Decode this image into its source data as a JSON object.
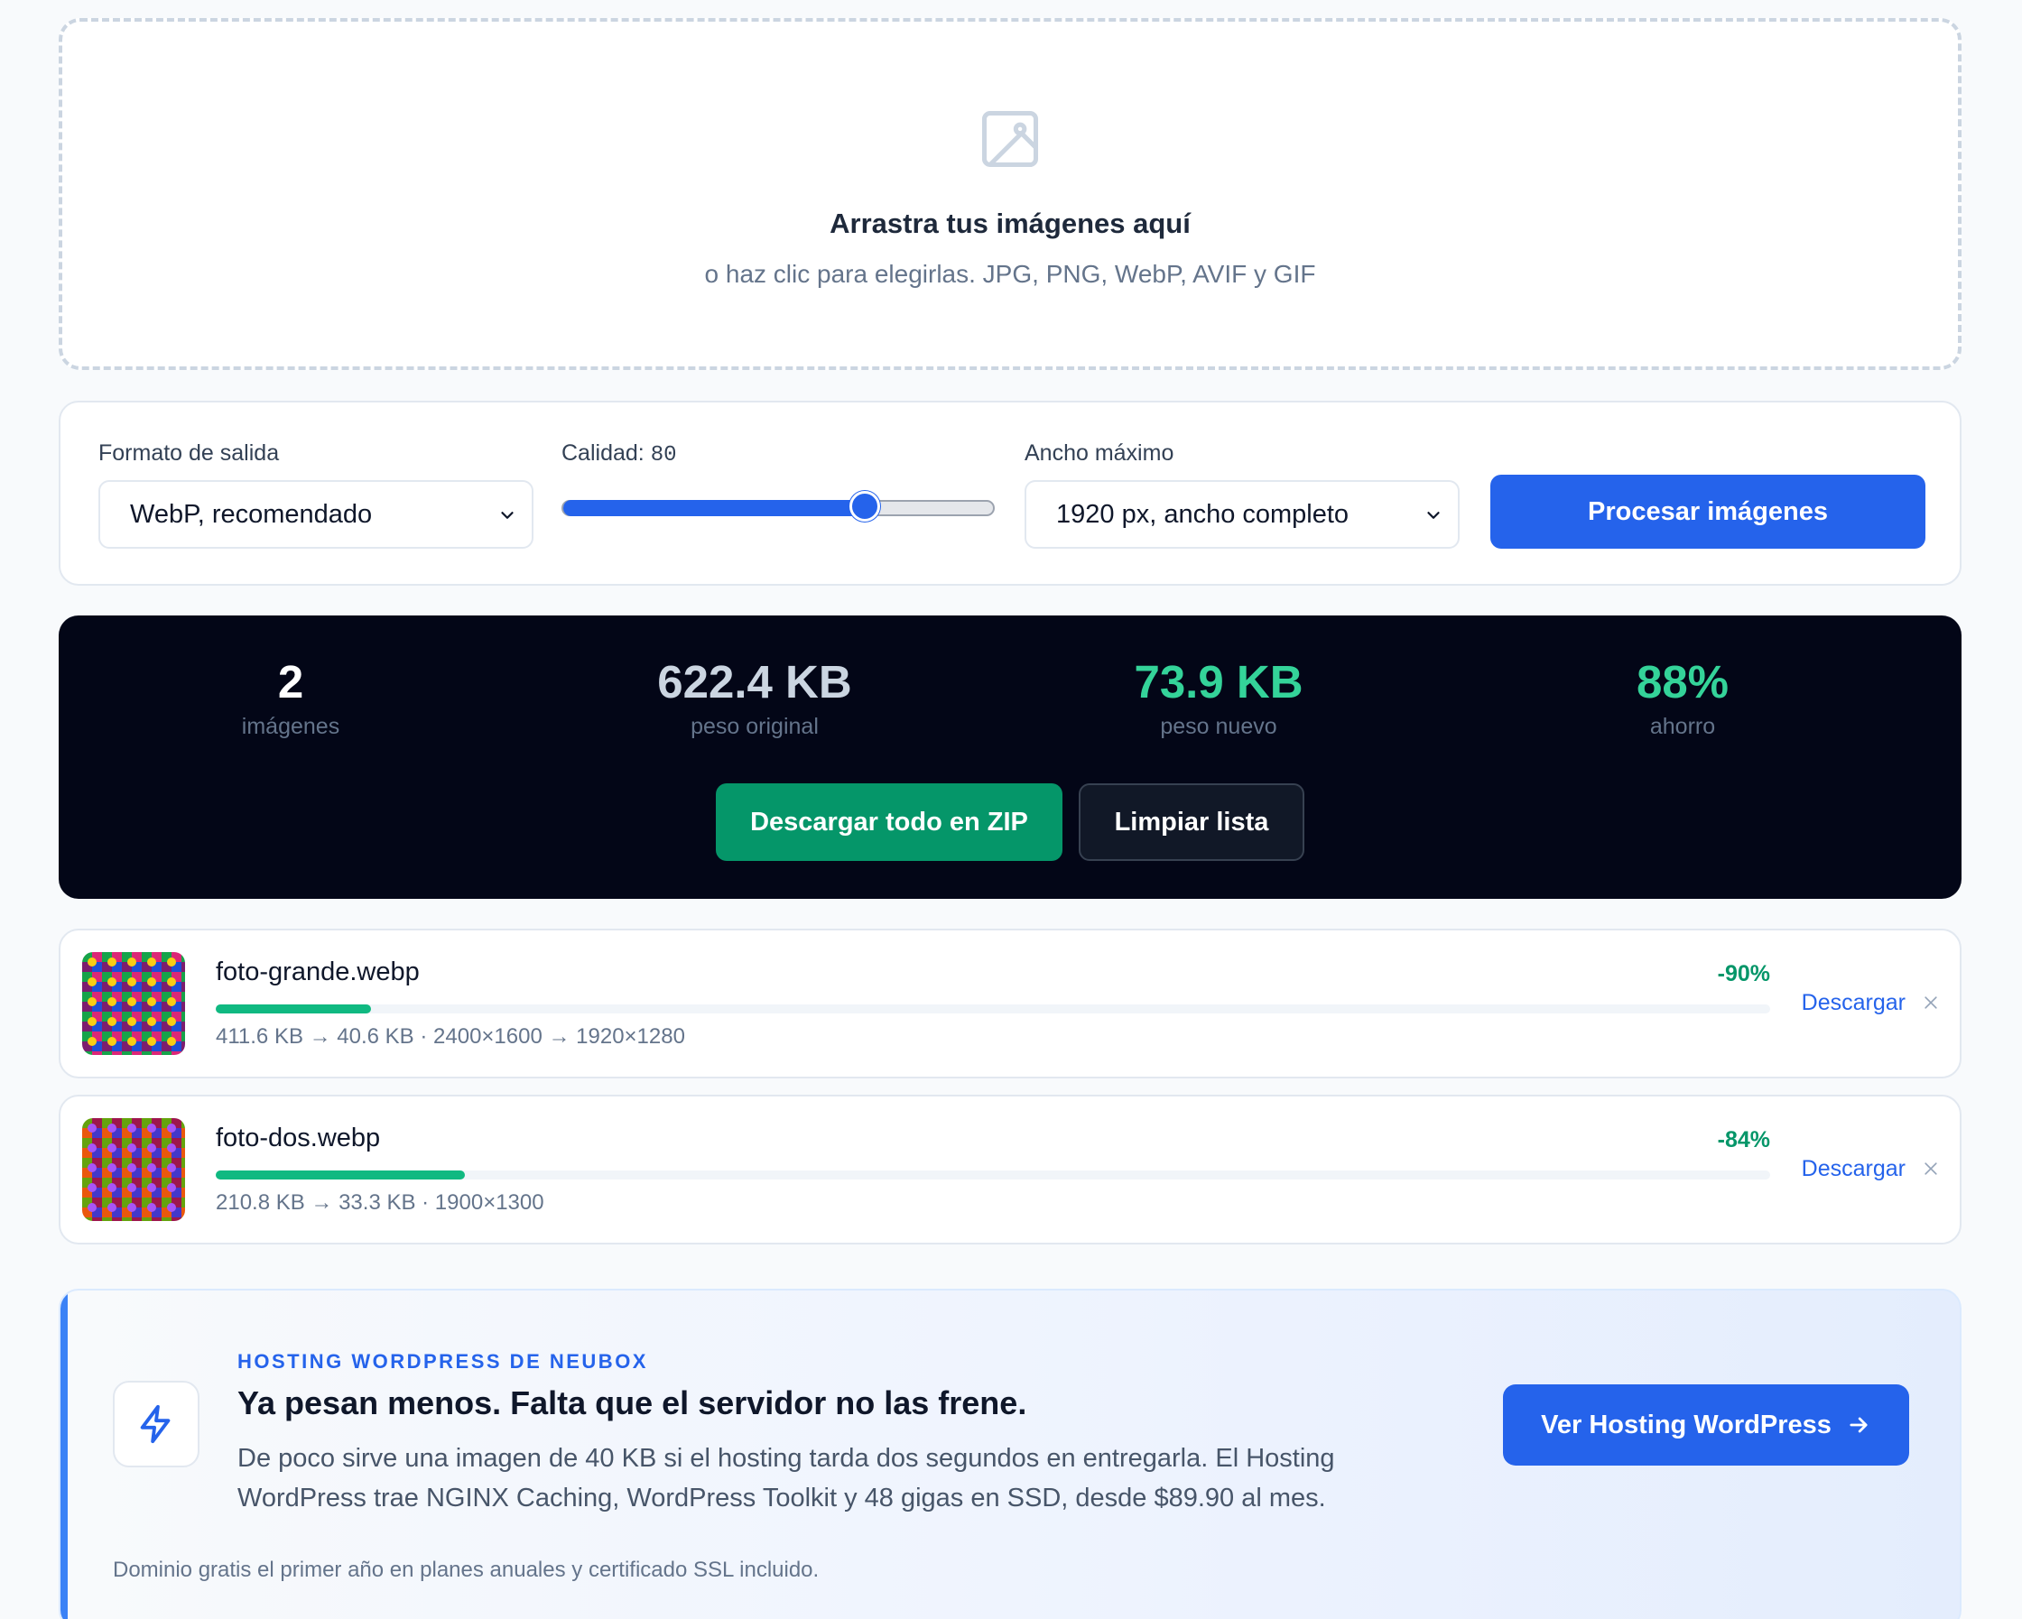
{
  "dropzone": {
    "icon": "image-icon",
    "title": "Arrastra tus imágenes aquí",
    "subtitle": "o haz clic para elegirlas. JPG, PNG, WebP, AVIF y GIF"
  },
  "options": {
    "format_label": "Formato de salida",
    "format_value": "WebP, recomendado",
    "quality_label": "Calidad:",
    "quality_value": "80",
    "quality_fraction": 0.7,
    "width_label": "Ancho máximo",
    "width_value": "1920 px, ancho completo",
    "process_label": "Procesar imágenes"
  },
  "stats": {
    "count": "2",
    "count_label": "imágenes",
    "original": "622.4 KB",
    "original_label": "peso original",
    "new": "73.9 KB",
    "new_label": "peso nuevo",
    "saving": "88%",
    "saving_label": "ahorro",
    "zip_label": "Descargar todo en ZIP",
    "clear_label": "Limpiar lista",
    "colors": {
      "white": "#ffffff",
      "muted": "#cbd5e1",
      "green": "#34d399"
    }
  },
  "files": [
    {
      "name": "foto-grande.webp",
      "percent": "-90%",
      "progress": 0.1,
      "meta": "411.6 KB → 40.6 KB · 2400×1600 → 1920×1280",
      "download": "Descargar"
    },
    {
      "name": "foto-dos.webp",
      "percent": "-84%",
      "progress": 0.16,
      "meta": "210.8 KB → 33.3 KB · 1900×1300",
      "download": "Descargar"
    }
  ],
  "promo": {
    "icon": "lightning-icon",
    "kicker": "HOSTING WORDPRESS DE NEUBOX",
    "title": "Ya pesan menos. Falta que el servidor no las frene.",
    "body": "De poco sirve una imagen de 40 KB si el hosting tarda dos segundos en entregarla. El Hosting WordPress trae NGINX Caching, WordPress Toolkit y 48 gigas en SSD, desde $89.90 al mes.",
    "button": "Ver Hosting WordPress",
    "footnote": "Dominio gratis el primer año en planes anuales y certificado SSL incluido."
  },
  "colors": {
    "accent": "#2563eb",
    "success": "#059669",
    "dark": "#030617"
  }
}
